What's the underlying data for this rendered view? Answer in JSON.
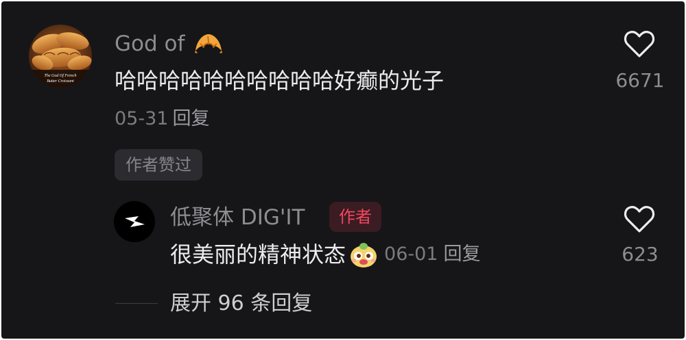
{
  "comment": {
    "username": "God of",
    "username_emoji": "croissant-emoji",
    "text": "哈哈哈哈哈哈哈哈哈哈好癫的光子",
    "date": "05-31",
    "reply_label": "回复",
    "author_liked_label": "作者赞过",
    "like_count": "6671",
    "avatar_caption": "The God Of French Butter Croissant"
  },
  "reply": {
    "username": "低聚体 DIG'IT",
    "author_badge": "作者",
    "text": "很美丽的精神状态",
    "emoji": "bear-face-emoji",
    "date": "06-01",
    "reply_label": "回复",
    "like_count": "623"
  },
  "expand": {
    "label": "展开 96 条回复"
  },
  "colors": {
    "background": "#161619",
    "author_badge_text": "#f24660",
    "author_badge_bg": "#3a1c22"
  }
}
